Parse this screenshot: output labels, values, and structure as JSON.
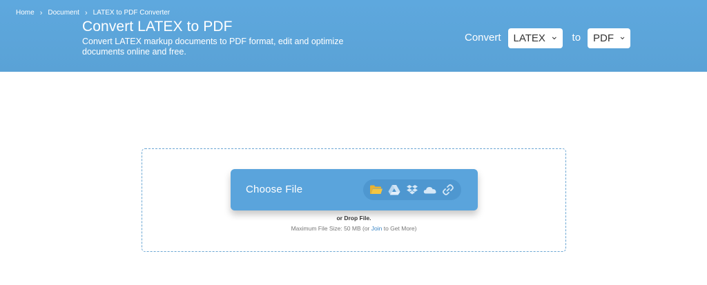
{
  "breadcrumb": {
    "items": [
      "Home",
      "Document",
      "LATEX to PDF Converter"
    ]
  },
  "header": {
    "title": "Convert LATEX to PDF",
    "subtitle": "Convert LATEX markup documents to PDF format, edit and optimize documents online and free."
  },
  "convert_bar": {
    "convert_label": "Convert",
    "from_value": "LATEX",
    "to_label": "to",
    "to_value": "PDF"
  },
  "upload": {
    "choose_label": "Choose File",
    "drop_label": "or Drop File.",
    "size_prefix": "Maximum File Size: 50 MB (or ",
    "join_label": "Join",
    "size_suffix": " to Get More)",
    "sources": [
      "folder-icon",
      "google-drive-icon",
      "dropbox-icon",
      "onedrive-icon",
      "link-icon"
    ]
  },
  "colors": {
    "header_bg": "#5aa2d6",
    "button_bg": "#5aa4dc",
    "folder_icon": "#f5c542",
    "link": "#3b86c5"
  }
}
